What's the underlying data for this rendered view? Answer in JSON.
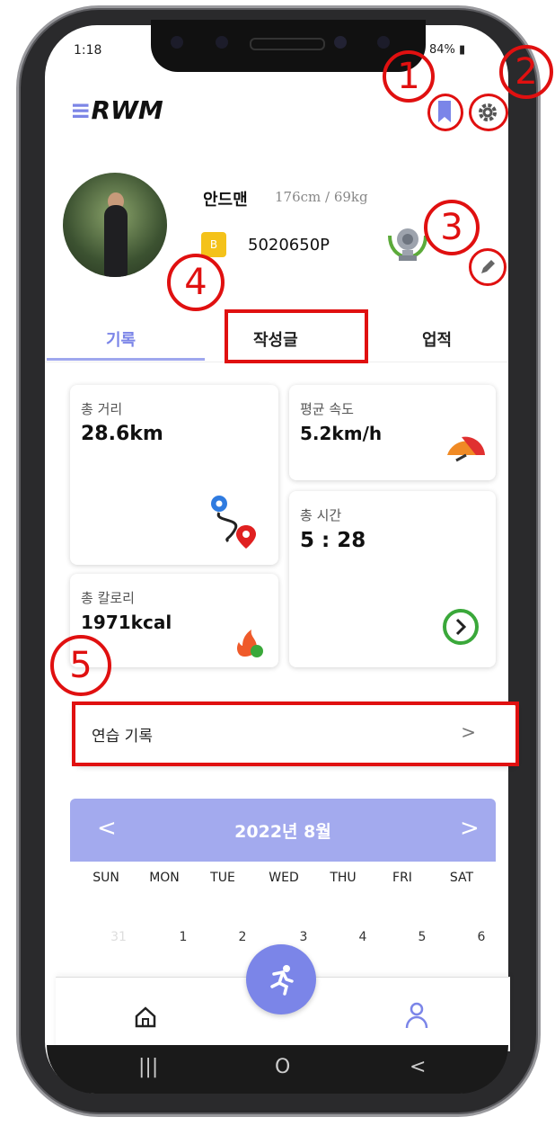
{
  "status_bar": {
    "time": "1:18",
    "battery": "84%"
  },
  "app": {
    "logo_prefix": "≡",
    "logo": "RWM"
  },
  "header": {
    "bookmark_icon": "bookmark-icon",
    "settings_icon": "gear-icon"
  },
  "profile": {
    "name": "안드맨",
    "body_stats": "176cm / 69kg",
    "coin_label": "B",
    "points": "5020650P",
    "edit_icon": "pencil-icon",
    "trophy_icon": "trophy-icon"
  },
  "tabs": [
    {
      "label": "기록"
    },
    {
      "label": "작성글"
    },
    {
      "label": "업적"
    }
  ],
  "stats": {
    "distance": {
      "label": "총 거리",
      "value": "28.6km"
    },
    "speed": {
      "label": "평균 속도",
      "value": "5.2km/h"
    },
    "time": {
      "label": "총 시간",
      "value": "5 : 28"
    },
    "calories": {
      "label": "총 칼로리",
      "value": "1971kcal"
    }
  },
  "practice": {
    "label": "연습 기록",
    "chevron": ">"
  },
  "calendar": {
    "title": "2022년 8월",
    "prev": "<",
    "next": ">",
    "weekdays": [
      "SUN",
      "MON",
      "TUE",
      "WED",
      "THU",
      "FRI",
      "SAT"
    ],
    "first_row": [
      "31",
      "1",
      "2",
      "3",
      "4",
      "5",
      "6"
    ]
  },
  "annotations": [
    "1",
    "2",
    "3",
    "4",
    "5"
  ],
  "colors": {
    "accent": "#7b85e8",
    "annotation": "#e01010"
  },
  "nav": {
    "home_icon": "home-icon",
    "profile_icon": "profile-icon",
    "run_icon": "running-icon"
  },
  "system_nav": {
    "recent": "|||",
    "home": "O",
    "back": "<"
  }
}
